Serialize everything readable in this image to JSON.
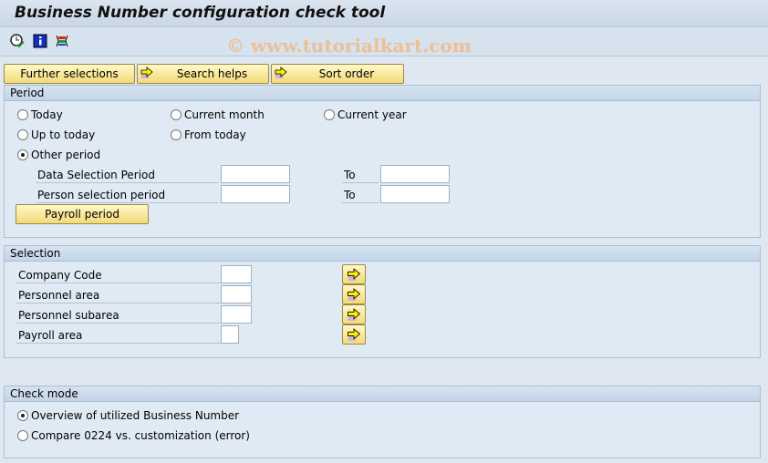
{
  "title": "Business Number configuration check tool",
  "watermark": "© www.tutorialkart.com",
  "toolbar": {
    "icons": [
      "execute-clock-icon",
      "info-icon",
      "selection-options-icon"
    ]
  },
  "buttons": {
    "further_selections": "Further selections",
    "search_helps": "Search helps",
    "sort_order": "Sort order"
  },
  "period": {
    "header": "Period",
    "radios": [
      {
        "label": "Today",
        "selected": false
      },
      {
        "label": "Current month",
        "selected": false
      },
      {
        "label": "Current year",
        "selected": false
      },
      {
        "label": "Up to today",
        "selected": false
      },
      {
        "label": "From today",
        "selected": false
      },
      {
        "label": "Other period",
        "selected": true
      }
    ],
    "fields": [
      {
        "label": "Data Selection Period",
        "from": "",
        "to_label": "To",
        "to": ""
      },
      {
        "label": "Person selection period",
        "from": "",
        "to_label": "To",
        "to": ""
      }
    ],
    "payroll_button": "Payroll period"
  },
  "selection": {
    "header": "Selection",
    "fields": [
      {
        "label": "Company Code",
        "value": ""
      },
      {
        "label": "Personnel area",
        "value": ""
      },
      {
        "label": "Personnel subarea",
        "value": ""
      },
      {
        "label": "Payroll area",
        "value": ""
      }
    ]
  },
  "check_mode": {
    "header": "Check mode",
    "radios": [
      {
        "label": "Overview of utilized Business Number",
        "selected": true
      },
      {
        "label": "Compare 0224 vs. customization (error)",
        "selected": false
      }
    ]
  }
}
